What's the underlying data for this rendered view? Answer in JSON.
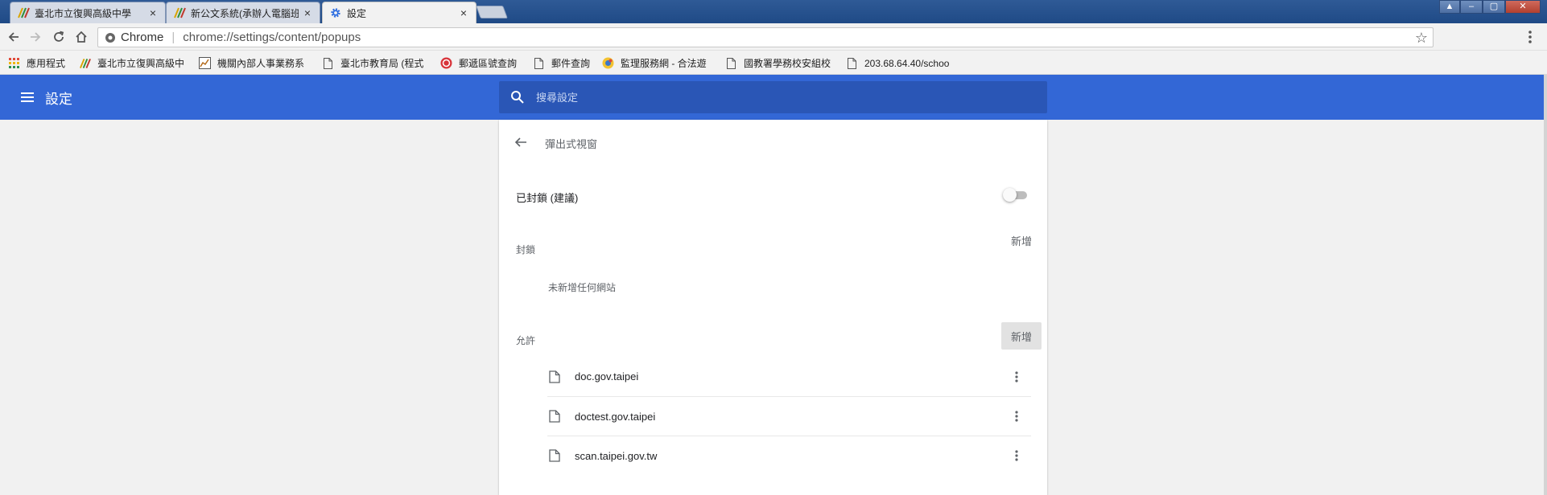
{
  "tabs": [
    {
      "title": "臺北市立復興高級中學",
      "close": "×"
    },
    {
      "title": "新公文系統(承辦人電腦班",
      "close": "×"
    },
    {
      "title": "設定",
      "close": "×"
    }
  ],
  "toolbar": {
    "omnibox_scheme": "Chrome",
    "omnibox_separator": "|",
    "omnibox_url": "chrome://settings/content/popups"
  },
  "bookmarks": [
    {
      "label": "應用程式",
      "icon": "apps-grid-icon"
    },
    {
      "label": "臺北市立復興高級中",
      "icon": "school-logo-icon"
    },
    {
      "label": "機關內部人事業務系",
      "icon": "chart-image-icon"
    },
    {
      "label": "臺北市教育局 (程式",
      "icon": "page-icon"
    },
    {
      "label": "郵遞區號查詢",
      "icon": "post-logo-icon"
    },
    {
      "label": "郵件查詢",
      "icon": "page-icon"
    },
    {
      "label": "監理服務網 - 合法遊",
      "icon": "moto-logo-icon"
    },
    {
      "label": "國教署學務校安組校",
      "icon": "page-icon"
    },
    {
      "label": "203.68.64.40/schoo",
      "icon": "page-icon"
    }
  ],
  "header": {
    "title": "設定",
    "search_placeholder": "搜尋設定"
  },
  "popups": {
    "subpage_title": "彈出式視窗",
    "toggle_label": "已封鎖 (建議)",
    "toggle_on": false,
    "block": {
      "label": "封鎖",
      "add_label": "新增",
      "empty_text": "未新增任何網站"
    },
    "allow": {
      "label": "允許",
      "add_label": "新增",
      "sites": [
        "doc.gov.taipei",
        "doctest.gov.taipei",
        "scan.taipei.gov.tw"
      ]
    }
  },
  "colors": {
    "header_blue": "#3367d6",
    "search_blue": "#2a56b6"
  }
}
